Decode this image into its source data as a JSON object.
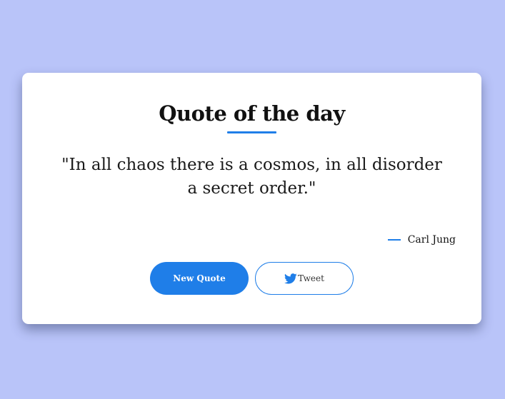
{
  "colors": {
    "background": "#b9c4f9",
    "card": "#ffffff",
    "accent": "#1f7ee8",
    "text": "#111111"
  },
  "card": {
    "title": "Quote of the day",
    "quote": "\"In all chaos there is a cosmos, in all disorder a secret order.\"",
    "author": "Carl Jung"
  },
  "buttons": {
    "new_quote_label": "New Quote",
    "tweet_label": "Tweet",
    "tweet_icon": "twitter-bird-icon"
  }
}
